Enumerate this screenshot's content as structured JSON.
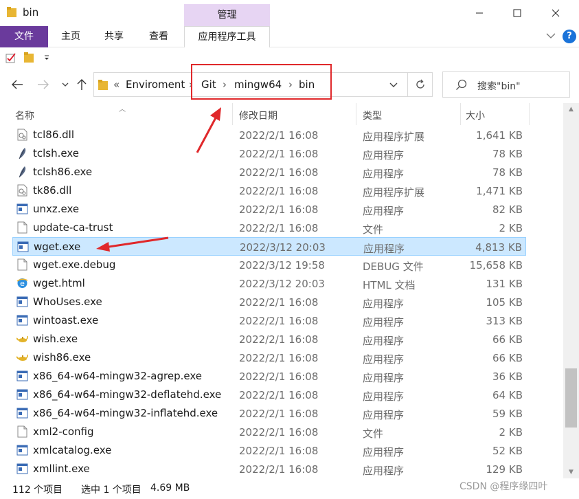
{
  "window": {
    "title": "bin",
    "context_tab_label": "管理"
  },
  "ribbon": {
    "tabs": [
      {
        "label": "文件"
      },
      {
        "label": "主页"
      },
      {
        "label": "共享"
      },
      {
        "label": "查看"
      },
      {
        "label": "应用程序工具"
      }
    ],
    "help_label": "?"
  },
  "address": {
    "overflow": "«",
    "segments": [
      "Enviroment",
      "Git",
      "mingw64",
      "bin"
    ],
    "separator": "›"
  },
  "search": {
    "placeholder": "搜索\"bin\""
  },
  "columns": {
    "name": "名称",
    "date": "修改日期",
    "type": "类型",
    "size": "大小"
  },
  "files": [
    {
      "name": "tcl86.dll",
      "date": "2022/2/1 16:08",
      "type": "应用程序扩展",
      "size": "1,641 KB",
      "icon": "dll-icon"
    },
    {
      "name": "tclsh.exe",
      "date": "2022/2/1 16:08",
      "type": "应用程序",
      "size": "78 KB",
      "icon": "feather-icon"
    },
    {
      "name": "tclsh86.exe",
      "date": "2022/2/1 16:08",
      "type": "应用程序",
      "size": "78 KB",
      "icon": "feather-icon"
    },
    {
      "name": "tk86.dll",
      "date": "2022/2/1 16:08",
      "type": "应用程序扩展",
      "size": "1,471 KB",
      "icon": "dll-icon"
    },
    {
      "name": "unxz.exe",
      "date": "2022/2/1 16:08",
      "type": "应用程序",
      "size": "82 KB",
      "icon": "exe-icon"
    },
    {
      "name": "update-ca-trust",
      "date": "2022/2/1 16:08",
      "type": "文件",
      "size": "2 KB",
      "icon": "file-icon"
    },
    {
      "name": "wget.exe",
      "date": "2022/3/12 20:03",
      "type": "应用程序",
      "size": "4,813 KB",
      "icon": "exe-icon",
      "selected": true
    },
    {
      "name": "wget.exe.debug",
      "date": "2022/3/12 19:58",
      "type": "DEBUG 文件",
      "size": "15,658 KB",
      "icon": "file-icon"
    },
    {
      "name": "wget.html",
      "date": "2022/3/12 20:03",
      "type": "HTML 文档",
      "size": "131 KB",
      "icon": "html-icon"
    },
    {
      "name": "WhoUses.exe",
      "date": "2022/2/1 16:08",
      "type": "应用程序",
      "size": "105 KB",
      "icon": "exe-icon"
    },
    {
      "name": "wintoast.exe",
      "date": "2022/2/1 16:08",
      "type": "应用程序",
      "size": "313 KB",
      "icon": "exe-icon"
    },
    {
      "name": "wish.exe",
      "date": "2022/2/1 16:08",
      "type": "应用程序",
      "size": "66 KB",
      "icon": "lamp-icon"
    },
    {
      "name": "wish86.exe",
      "date": "2022/2/1 16:08",
      "type": "应用程序",
      "size": "66 KB",
      "icon": "lamp-icon"
    },
    {
      "name": "x86_64-w64-mingw32-agrep.exe",
      "date": "2022/2/1 16:08",
      "type": "应用程序",
      "size": "36 KB",
      "icon": "exe-icon"
    },
    {
      "name": "x86_64-w64-mingw32-deflatehd.exe",
      "date": "2022/2/1 16:08",
      "type": "应用程序",
      "size": "64 KB",
      "icon": "exe-icon"
    },
    {
      "name": "x86_64-w64-mingw32-inflatehd.exe",
      "date": "2022/2/1 16:08",
      "type": "应用程序",
      "size": "59 KB",
      "icon": "exe-icon"
    },
    {
      "name": "xml2-config",
      "date": "2022/2/1 16:08",
      "type": "文件",
      "size": "2 KB",
      "icon": "file-icon"
    },
    {
      "name": "xmlcatalog.exe",
      "date": "2022/2/1 16:08",
      "type": "应用程序",
      "size": "52 KB",
      "icon": "exe-icon"
    },
    {
      "name": "xmllint.exe",
      "date": "2022/2/1 16:08",
      "type": "应用程序",
      "size": "129 KB",
      "icon": "exe-icon"
    }
  ],
  "status": {
    "item_count": "112 个项目",
    "selection": "选中 1 个项目",
    "selection_size": "4.69 MB"
  },
  "watermark": "CSDN @程序缘四叶",
  "colors": {
    "accent_file_tab": "#6a3a9c",
    "context_tab": "#e7d5f3",
    "selection_bg": "#cce8ff",
    "annotation_red": "#e0282b"
  }
}
